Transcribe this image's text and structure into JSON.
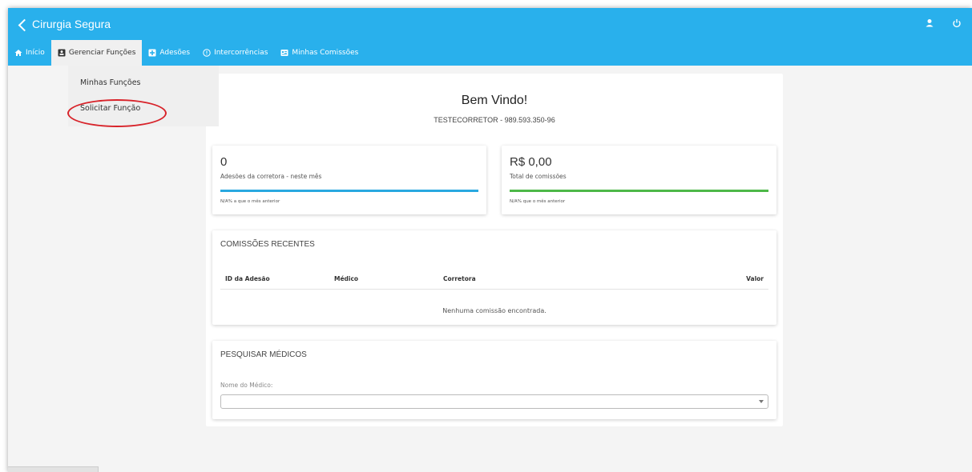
{
  "app": {
    "title": "Cirurgia Segura"
  },
  "nav": {
    "items": [
      {
        "label": "Início",
        "icon": "home-icon"
      },
      {
        "label": "Gerenciar Funções",
        "icon": "id-card-icon"
      },
      {
        "label": "Adesões",
        "icon": "plus-square-icon"
      },
      {
        "label": "Intercorrências",
        "icon": "alert-circle-icon"
      },
      {
        "label": "Minhas Comissões",
        "icon": "list-card-icon"
      }
    ]
  },
  "dropdown": {
    "items": [
      "Minhas Funções",
      "Solicitar Função"
    ]
  },
  "welcome": {
    "title": "Bem Vindo!",
    "user": "TESTECORRETOR - 989.593.350-96"
  },
  "stats": [
    {
      "value": "0",
      "label": "Adesões da corretora - neste mês",
      "note": "N/A% a que o mês anterior",
      "color": "#29a8e0",
      "progress": 100
    },
    {
      "value": "R$ 0,00",
      "label": "Total de comissões",
      "note": "N/A% que o mês anterior",
      "color": "#4db848",
      "progress": 100
    }
  ],
  "recent": {
    "title": "COMISSÕES RECENTES",
    "headers": [
      "ID da Adesão",
      "Médico",
      "Corretora",
      "Valor"
    ],
    "empty": "Nenhuma comissão encontrada."
  },
  "search": {
    "title": "PESQUISAR MÉDICOS",
    "label": "Nome do Médico:",
    "value": ""
  },
  "colors": {
    "header": "#29b0ec",
    "annotation": "#d8232a"
  }
}
